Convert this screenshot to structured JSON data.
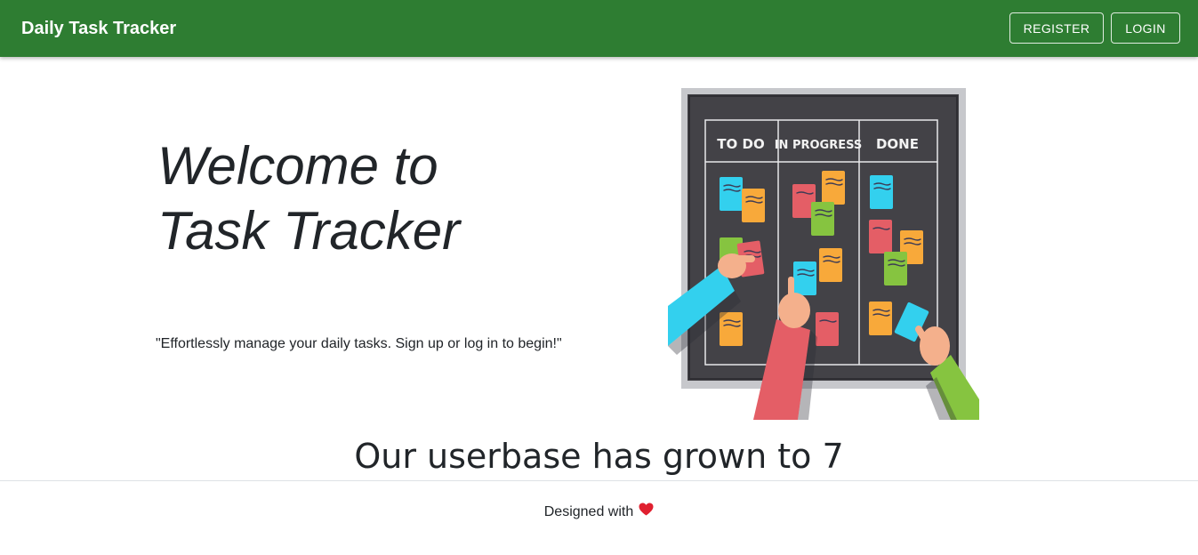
{
  "navbar": {
    "brand": "Daily Task Tracker",
    "register_label": "REGISTER",
    "login_label": "LOGIN",
    "background_color": "#2e7d32"
  },
  "hero": {
    "title": "Welcome to Task Tracker",
    "subtitle": "\"Effortlessly manage your daily tasks. Sign up or log in to begin!\""
  },
  "illustration": {
    "columns": [
      "TO DO",
      "IN PROGRESS",
      "DONE"
    ]
  },
  "stats": {
    "userbase_text": "Our userbase has grown to 7"
  },
  "footer": {
    "text": "Designed with",
    "icon": "heart-icon",
    "heart_color": "#e0202f"
  }
}
